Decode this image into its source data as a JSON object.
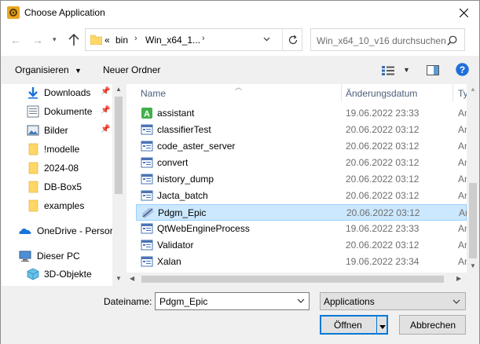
{
  "window": {
    "title": "Choose Application"
  },
  "address": {
    "overflow": "«",
    "crumbs": [
      "bin",
      "Win_x64_1..."
    ],
    "search_placeholder": "Win_x64_10_v16 durchsuchen"
  },
  "toolbar": {
    "organize_label": "Organisieren",
    "new_folder_label": "Neuer Ordner"
  },
  "nav_pane": {
    "items": [
      {
        "label": "Downloads",
        "icon": "downloads-icon",
        "pinned": true
      },
      {
        "label": "Dokumente",
        "icon": "documents-icon",
        "pinned": true
      },
      {
        "label": "Bilder",
        "icon": "pictures-icon",
        "pinned": true
      },
      {
        "label": "!modelle",
        "icon": "folder-icon",
        "pinned": false
      },
      {
        "label": "2024-08",
        "icon": "folder-icon",
        "pinned": false
      },
      {
        "label": "DB-Box5",
        "icon": "folder-icon",
        "pinned": false
      },
      {
        "label": "examples",
        "icon": "folder-icon",
        "pinned": false
      },
      {
        "label": "OneDrive - Persor",
        "icon": "onedrive-icon",
        "pinned": false
      },
      {
        "label": "Dieser PC",
        "icon": "pc-icon",
        "pinned": false
      },
      {
        "label": "3D-Objekte",
        "icon": "3d-objects-icon",
        "pinned": false
      }
    ]
  },
  "columns": {
    "name": "Name",
    "date": "Änderungsdatum",
    "type": "Ty"
  },
  "files": [
    {
      "name": "assistant",
      "date": "19.06.2022 23:33",
      "type": "An",
      "icon": "assistant-app-icon"
    },
    {
      "name": "classifierTest",
      "date": "20.06.2022 03:12",
      "type": "An",
      "icon": "exe-icon"
    },
    {
      "name": "code_aster_server",
      "date": "20.06.2022 03:12",
      "type": "An",
      "icon": "exe-icon"
    },
    {
      "name": "convert",
      "date": "20.06.2022 03:12",
      "type": "An",
      "icon": "exe-icon"
    },
    {
      "name": "history_dump",
      "date": "20.06.2022 03:12",
      "type": "An",
      "icon": "exe-icon"
    },
    {
      "name": "Jacta_batch",
      "date": "20.06.2022 03:12",
      "type": "An",
      "icon": "exe-icon"
    },
    {
      "name": "Pdgm_Epic",
      "date": "20.06.2022 03:12",
      "type": "An",
      "icon": "pdgm-epic-icon",
      "selected": true
    },
    {
      "name": "QtWebEngineProcess",
      "date": "19.06.2022 23:33",
      "type": "An",
      "icon": "exe-icon"
    },
    {
      "name": "Validator",
      "date": "20.06.2022 03:12",
      "type": "An",
      "icon": "exe-icon"
    },
    {
      "name": "Xalan",
      "date": "19.06.2022 23:34",
      "type": "An",
      "icon": "exe-icon"
    }
  ],
  "bottom": {
    "filename_label": "Dateiname:",
    "filename_value": "Pdgm_Epic",
    "filetype_value": "Applications",
    "open_label": "Öffnen",
    "cancel_label": "Abbrechen"
  },
  "colors": {
    "selection": "#cce8ff",
    "selection_border": "#99d1ff",
    "accent": "#0078d7",
    "folder": "#ffd766"
  }
}
